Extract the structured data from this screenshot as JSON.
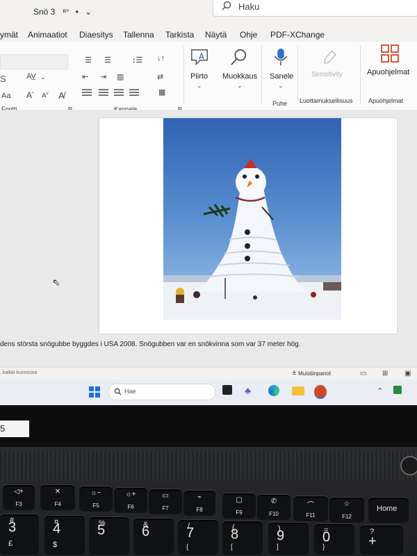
{
  "window": {
    "doc_title": "Snö 3",
    "search_placeholder": "Haku"
  },
  "menu": {
    "items": [
      "ymät",
      "Animaatiot",
      "Diaesitys",
      "Tallenna",
      "Tarkista",
      "Näytä",
      "Ohje",
      "PDF-XChange"
    ]
  },
  "ribbon": {
    "font_group_label": "Fontti",
    "paragraph_group_label": "Kappale",
    "draw_label": "Piirto",
    "edit_label": "Muokkaus",
    "dictate_label": "Sanele",
    "speech_group_label": "Puhe",
    "sensitivity_label": "Sensitivity",
    "privacy_group_label": "Luottamuksellisuus",
    "addins_label": "Apuohjelmat",
    "addins_group_label": "Apuohjelmat"
  },
  "document": {
    "caption": "dens största snögubbe byggdes i USA  2008. Snögubben var en snökvinna som var 37 meter hög."
  },
  "status": {
    "left_text": ", kaikki kunnossa",
    "notes_label": "Muistiinpanot"
  },
  "taskbar": {
    "search_text": "Hae"
  },
  "bezel": {
    "sticker_text": "5"
  },
  "keyboard": {
    "function_keys": [
      {
        "label": "F3"
      },
      {
        "label": "F4"
      },
      {
        "label": "F5"
      },
      {
        "label": "F6"
      },
      {
        "label": "F7"
      },
      {
        "label": "F8"
      },
      {
        "label": "F9"
      },
      {
        "label": "F10"
      },
      {
        "label": "F11"
      },
      {
        "label": "F12"
      }
    ],
    "home_label": "Home",
    "number_keys": [
      {
        "main": "3",
        "shift": "#",
        "alt": "£"
      },
      {
        "main": "4",
        "shift": "¤",
        "alt": "$"
      },
      {
        "main": "5",
        "shift": "%",
        "alt": ""
      },
      {
        "main": "6",
        "shift": "&",
        "alt": ""
      },
      {
        "main": "7",
        "shift": "/",
        "alt": "{"
      },
      {
        "main": "8",
        "shift": "(",
        "alt": "["
      },
      {
        "main": "9",
        "shift": ")",
        "alt": "]"
      },
      {
        "main": "0",
        "shift": "=",
        "alt": "}"
      },
      {
        "main": "+",
        "shift": "?",
        "alt": ""
      }
    ]
  }
}
